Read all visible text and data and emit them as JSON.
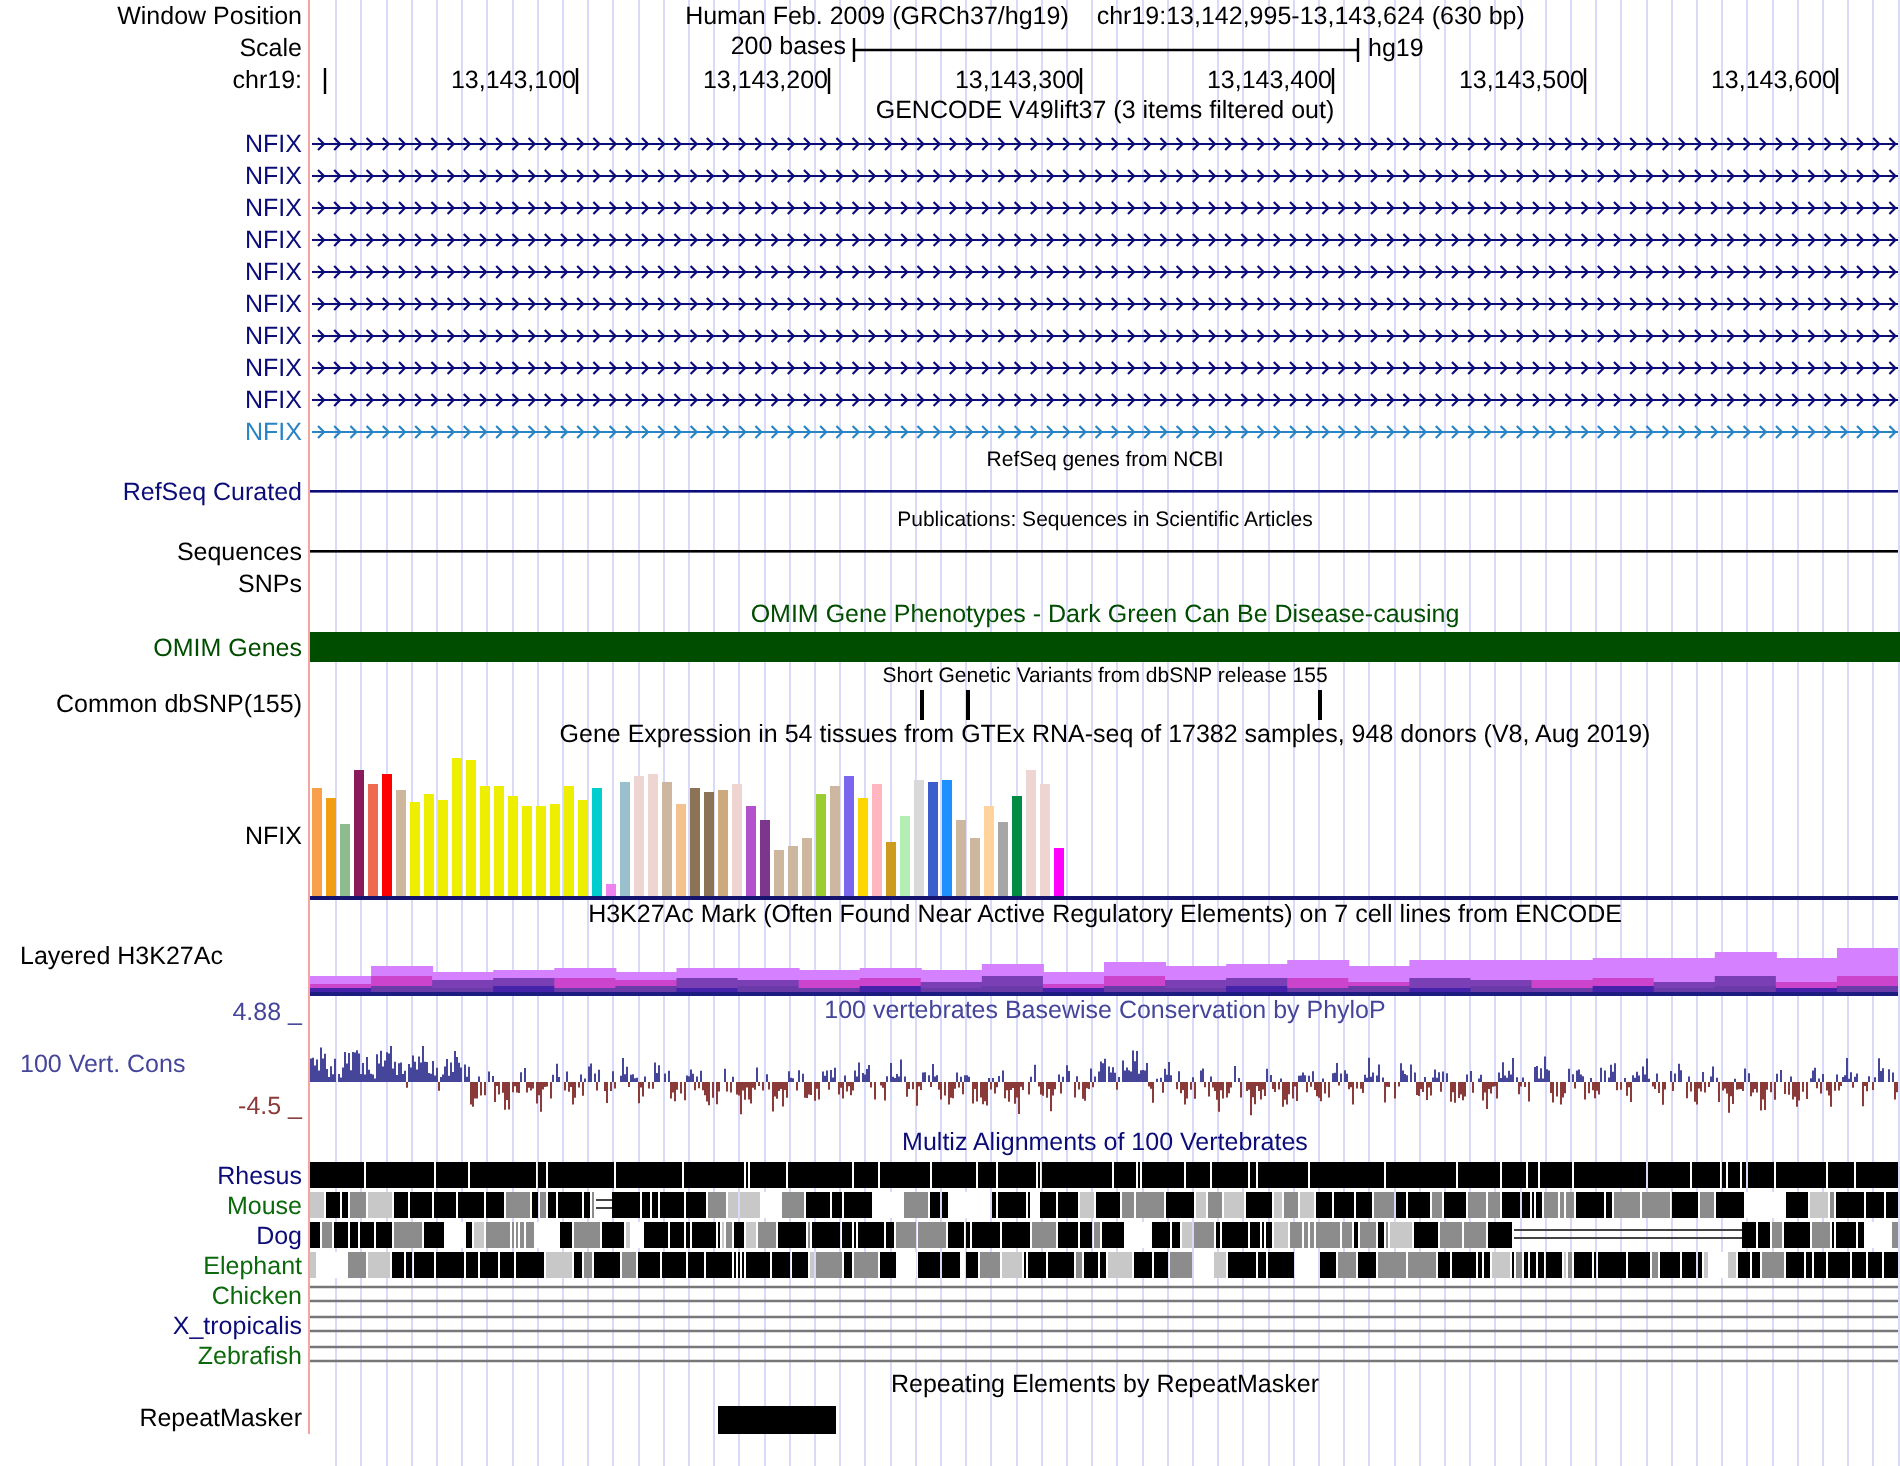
{
  "header": {
    "label": "Window Position",
    "assembly": "Human Feb. 2009 (GRCh37/hg19)",
    "position": "chr19:13,142,995-13,143,624 (630 bp)"
  },
  "scale": {
    "label": "Scale",
    "length": "200 bases",
    "assembly": "hg19"
  },
  "ruler": {
    "label": "chr19:",
    "ticks": [
      "13,143,100",
      "13,143,200",
      "13,143,300",
      "13,143,400",
      "13,143,500",
      "13,143,600"
    ]
  },
  "tracks": [
    {
      "kind": "genes",
      "title": "GENCODE V49lift37 (3 items filtered out)",
      "items": [
        {
          "name": "NFIX",
          "color": "#0c0c78"
        },
        {
          "name": "NFIX",
          "color": "#0c0c78"
        },
        {
          "name": "NFIX",
          "color": "#0c0c78"
        },
        {
          "name": "NFIX",
          "color": "#0c0c78"
        },
        {
          "name": "NFIX",
          "color": "#0c0c78"
        },
        {
          "name": "NFIX",
          "color": "#0c0c78"
        },
        {
          "name": "NFIX",
          "color": "#0c0c78"
        },
        {
          "name": "NFIX",
          "color": "#0c0c78"
        },
        {
          "name": "NFIX",
          "color": "#0c0c78"
        },
        {
          "name": "NFIX",
          "color": "#2a84c4"
        }
      ]
    },
    {
      "kind": "line",
      "title": "RefSeq genes from NCBI",
      "label": "RefSeq Curated",
      "color": "#0c0c78"
    },
    {
      "kind": "line",
      "title": "Publications: Sequences in Scientific Articles",
      "label": "Sequences",
      "color": "#000000"
    },
    {
      "kind": "empty",
      "label": "SNPs",
      "color": "#000000"
    },
    {
      "kind": "bar",
      "title": "OMIM Gene Phenotypes - Dark Green Can Be Disease-causing",
      "label": "OMIM Genes",
      "color": "#004d00"
    },
    {
      "kind": "snps",
      "title": "Short Genetic Variants from dbSNP release 155",
      "label": "Common dbSNP(155)",
      "color": "#000000"
    },
    {
      "kind": "expression",
      "title": "Gene Expression in 54 tissues from GTEx RNA-seq of 17382 samples, 948 donors (V8, Aug 2019)",
      "label": "NFIX",
      "color": "#000000"
    },
    {
      "kind": "layered",
      "title": "H3K27Ac Mark (Often Found Near Active Regulatory Elements) on 7 cell lines from ENCODE",
      "label": "Layered H3K27Ac",
      "color": "#000000"
    },
    {
      "kind": "wiggle",
      "title": "100 vertebrates Basewise Conservation by PhyloP",
      "label": "100 Vert. Cons",
      "max": "4.88 _",
      "min": "-4.5 _",
      "color": "#45459a"
    },
    {
      "kind": "multiz",
      "title": "Multiz Alignments of 100 Vertebrates",
      "color": "#0c0c78",
      "species": [
        {
          "name": "Rhesus",
          "color": "#0c0c78",
          "kind": "blocks"
        },
        {
          "name": "Mouse",
          "color": "#0b690b",
          "kind": "blocks"
        },
        {
          "name": "Dog",
          "color": "#0c0c78",
          "kind": "blocks"
        },
        {
          "name": "Elephant",
          "color": "#0b690b",
          "kind": "blocks"
        },
        {
          "name": "Chicken",
          "color": "#0b690b",
          "kind": "lines"
        },
        {
          "name": "X_tropicalis",
          "color": "#0c0c78",
          "kind": "lines"
        },
        {
          "name": "Zebrafish",
          "color": "#0b690b",
          "kind": "lines"
        }
      ]
    },
    {
      "kind": "repeats",
      "title": "Repeating Elements by RepeatMasker",
      "label": "RepeatMasker",
      "color": "#000000"
    }
  ]
}
